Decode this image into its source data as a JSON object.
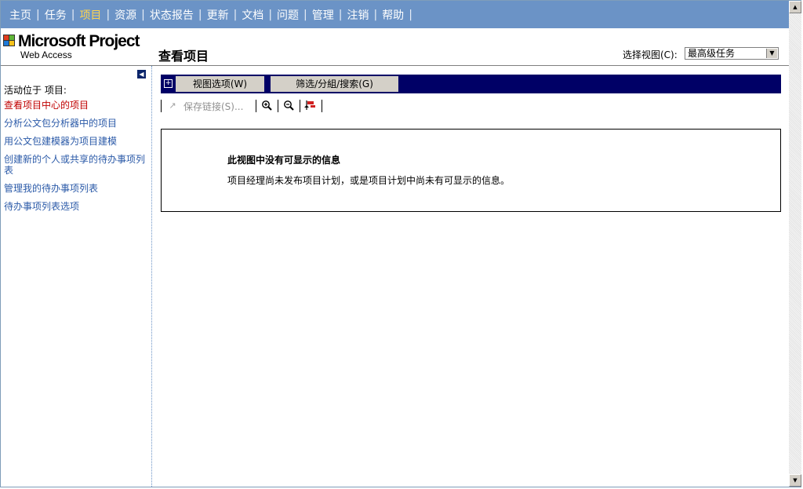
{
  "nav": {
    "items": [
      {
        "label": "主页",
        "active": false
      },
      {
        "label": "任务",
        "active": false
      },
      {
        "label": "项目",
        "active": true
      },
      {
        "label": "资源",
        "active": false
      },
      {
        "label": "状态报告",
        "active": false
      },
      {
        "label": "更新",
        "active": false
      },
      {
        "label": "文档",
        "active": false
      },
      {
        "label": "问题",
        "active": false
      },
      {
        "label": "管理",
        "active": false
      },
      {
        "label": "注销",
        "active": false
      },
      {
        "label": "帮助",
        "active": false
      }
    ],
    "separator": "|"
  },
  "logo": {
    "title": "Microsoft Project",
    "subtitle": "Web Access",
    "icon": "windows-flag-icon"
  },
  "header": {
    "page_title": "查看项目",
    "view_label": "选择视图(C):",
    "view_value": "最高级任务"
  },
  "sidebar": {
    "heading": "活动位于 项目:",
    "links": [
      "查看项目中心的项目",
      "分析公文包分析器中的项目",
      "用公文包建模器为项目建模",
      "创建新的个人或共享的待办事项列表",
      "管理我的待办事项列表",
      "待办事项列表选项"
    ]
  },
  "toolbar": {
    "view_options": "视图选项(W)",
    "filter": "筛选/分組/搜索(G)",
    "save_link": "保存链接(S)...",
    "icons": [
      "zoom-in-icon",
      "zoom-out-icon",
      "goto-task-icon"
    ]
  },
  "message": {
    "title": "此视图中没有可显示的信息",
    "text": "项目经理尚未发布项目计划，或是项目计划中尚未有可显示的信息。"
  },
  "colors": {
    "nav_bg": "#6b93c6",
    "active_nav": "#ffd34e",
    "toolbar_bg": "#000066",
    "link": "#2b5aa8",
    "current_link": "#c00000"
  }
}
